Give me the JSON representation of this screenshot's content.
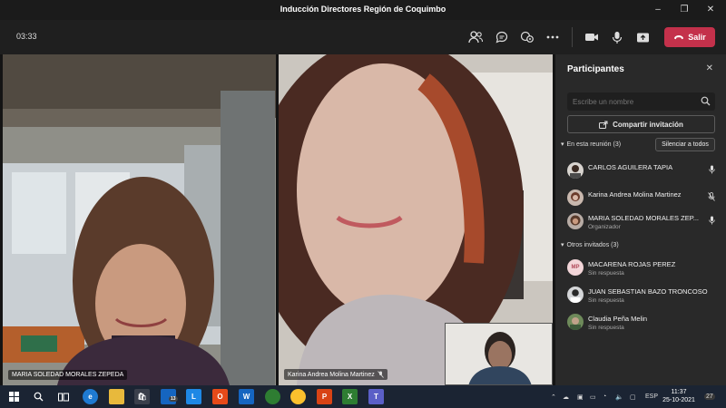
{
  "window": {
    "title": "Inducción Directores Región de Coquimbo",
    "minimize": "–",
    "maximize": "❐",
    "close": "✕"
  },
  "toolbar": {
    "timer": "03:33",
    "leave_label": "Salir"
  },
  "videos": {
    "tile1_name": "MARIA SOLEDAD MORALES ZEPEDA",
    "tile2_name": "Karina Andrea Molina Martinez"
  },
  "panel": {
    "title": "Participantes",
    "search_placeholder": "Escribe un nombre",
    "share_label": "Compartir invitación",
    "in_meeting_label": "En esta reunión (3)",
    "mute_all_label": "Silenciar a todos",
    "others_label": "Otros invitados (3)",
    "in_meeting": [
      {
        "name": "CARLOS AGUILERA TAPIA",
        "sub": ""
      },
      {
        "name": "Karina Andrea Molina Martinez",
        "sub": ""
      },
      {
        "name": "MARIA SOLEDAD MORALES ZEP...",
        "sub": "Organizador"
      }
    ],
    "others": [
      {
        "name": "MACARENA ROJAS PEREZ",
        "sub": "Sin respuesta",
        "initials": "MP"
      },
      {
        "name": "JUAN SEBASTIAN BAZO TRONCOSO",
        "sub": "Sin respuesta",
        "initials": ""
      },
      {
        "name": "Claudia Peña Melin",
        "sub": "Sin respuesta",
        "initials": ""
      }
    ]
  },
  "taskbar": {
    "teams_badge": "13",
    "lang": "ESP",
    "time": "11:37",
    "date": "25-10-2021",
    "notif": "27"
  },
  "colors": {
    "leave": "#c4314b",
    "panel": "#292929",
    "taskbar": "#1b2433"
  }
}
